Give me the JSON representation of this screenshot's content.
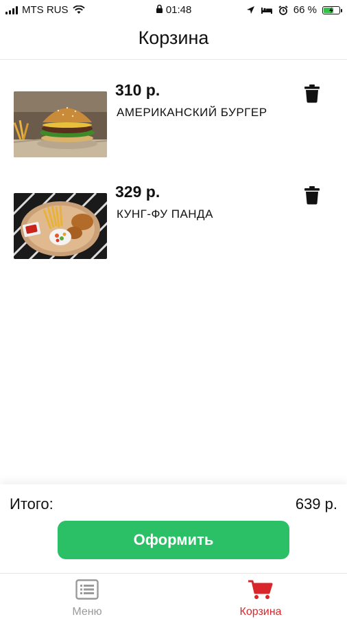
{
  "status_bar": {
    "carrier": "MTS RUS",
    "time": "01:48",
    "battery_percent": "66 %",
    "battery_level": 0.66
  },
  "header": {
    "title": "Корзина"
  },
  "cart": {
    "items": [
      {
        "price": "310 р.",
        "name": "АМЕРИКАНСКИЙ БУРГЕР"
      },
      {
        "price": "329 р.",
        "name": "КУНГ-ФУ ПАНДА"
      }
    ]
  },
  "summary": {
    "total_label": "Итого:",
    "total_value": "639 р.",
    "checkout_label": "Оформить"
  },
  "tabbar": {
    "menu_label": "Меню",
    "cart_label": "Корзина"
  },
  "colors": {
    "accent_green": "#2cc066",
    "active_tab_red": "#d8262a",
    "inactive_tab_gray": "#999999"
  }
}
